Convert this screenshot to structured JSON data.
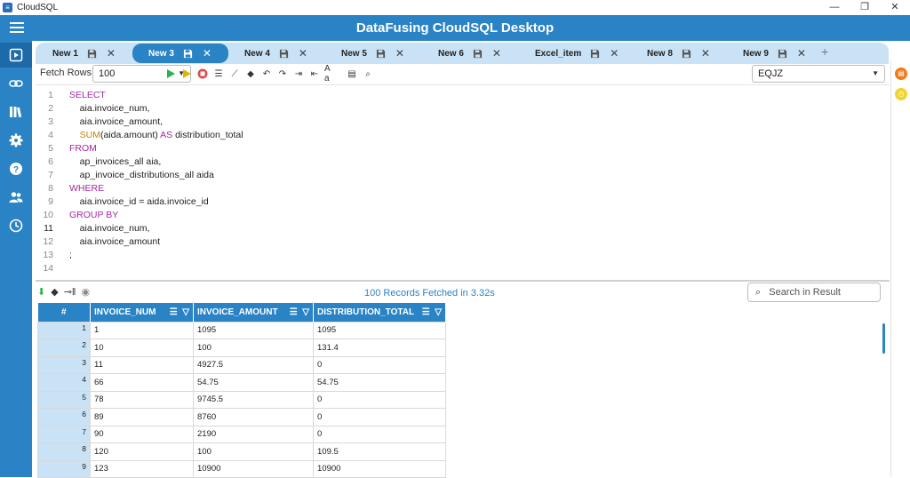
{
  "os": {
    "title": "CloudSQL",
    "controls": [
      "—",
      "❐",
      "✕"
    ]
  },
  "app": {
    "title": "DataFusing CloudSQL Desktop"
  },
  "nav": {
    "items": [
      "query-icon",
      "link-icon",
      "library-icon",
      "settings-icon",
      "help-icon",
      "users-icon",
      "history-icon"
    ]
  },
  "tabs": [
    {
      "label": "New 1"
    },
    {
      "label": "New 3",
      "active": true
    },
    {
      "label": "New 4"
    },
    {
      "label": "New 5"
    },
    {
      "label": "New 6"
    },
    {
      "label": "Excel_item"
    },
    {
      "label": "New 8"
    },
    {
      "label": "New 9"
    }
  ],
  "toolbar": {
    "fetch_label": "Fetch Rows",
    "fetch_value": "100",
    "schema_value": "EQJZ"
  },
  "editor": {
    "lines": [
      {
        "n": "1",
        "html": "<span class='kw'>SELECT</span>"
      },
      {
        "n": "2",
        "html": "    aia.invoice_num,"
      },
      {
        "n": "3",
        "html": "    aia.invoice_amount,"
      },
      {
        "n": "4",
        "html": "    <span class='fn'>SUM</span>(aida.amount) <span class='kw'>AS</span> distribution_total"
      },
      {
        "n": "5",
        "html": "<span class='kw'>FROM</span>"
      },
      {
        "n": "6",
        "html": "    ap_invoices_all aia,"
      },
      {
        "n": "7",
        "html": "    ap_invoice_distributions_all aida"
      },
      {
        "n": "8",
        "html": "<span class='kw'>WHERE</span>"
      },
      {
        "n": "9",
        "html": "    aia.invoice_id = aida.invoice_id"
      },
      {
        "n": "10",
        "html": "<span class='kw'>GROUP BY</span>"
      },
      {
        "n": "11",
        "html": "    aia.invoice_num,"
      },
      {
        "n": "12",
        "html": "    aia.invoice_amount"
      },
      {
        "n": "13",
        "html": ";"
      },
      {
        "n": "14",
        "html": ""
      }
    ],
    "current_line": "11"
  },
  "results": {
    "status": "100  Records Fetched in 3.32s",
    "search_placeholder": "Search in Result",
    "columns": [
      "#",
      "INVOICE_NUM",
      "INVOICE_AMOUNT",
      "DISTRIBUTION_TOTAL"
    ],
    "rows": [
      [
        "1",
        "1",
        "1095",
        "1095"
      ],
      [
        "2",
        "10",
        "100",
        "131.4"
      ],
      [
        "3",
        "11",
        "4927.5",
        "0"
      ],
      [
        "4",
        "66",
        "54.75",
        "54.75"
      ],
      [
        "5",
        "78",
        "9745.5",
        "0"
      ],
      [
        "6",
        "89",
        "8760",
        "0"
      ],
      [
        "7",
        "90",
        "2190",
        "0"
      ],
      [
        "8",
        "120",
        "100",
        "109.5"
      ],
      [
        "9",
        "123",
        "10900",
        "10900"
      ]
    ]
  },
  "colors": {
    "primary": "#2a83c5",
    "tab_strip": "#c9e2f5",
    "keyword": "#a626a4",
    "function": "#c18401"
  }
}
